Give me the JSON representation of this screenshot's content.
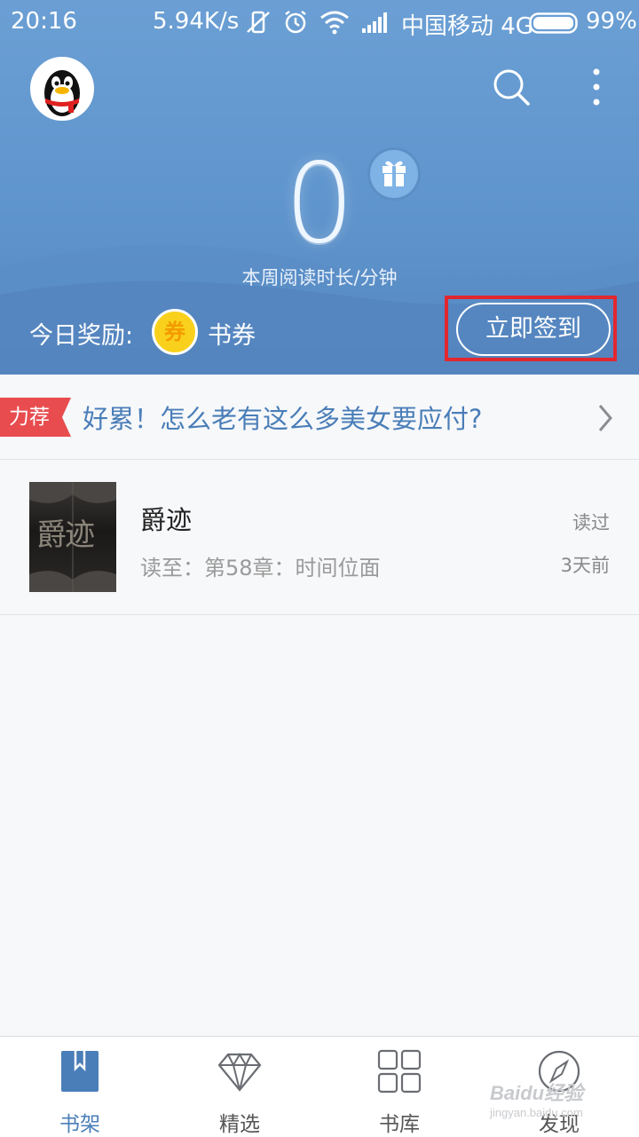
{
  "status_bar": {
    "time": "20:16",
    "speed": "5.94K/s",
    "carrier": "中国移动 4G",
    "battery": "99%",
    "battery_level": 0.99
  },
  "header": {
    "avatar_icon": "qq-penguin-avatar",
    "search_icon": "search-icon",
    "more_icon": "more-vertical-icon",
    "reading_minutes": "0",
    "reading_label": "本周阅读时长/分钟",
    "gift_icon": "gift-icon",
    "reward_label": "今日奖励:",
    "coupon_badge": "券",
    "coupon_text": "书券",
    "signin_label": "立即签到"
  },
  "recommendation": {
    "tag": "力荐",
    "text": "好累！怎么老有这么多美女要应付?"
  },
  "bookshelf": [
    {
      "title": "爵迹",
      "cover_text": "爵迹",
      "progress": "读至：第58章：时间位面",
      "status": "读过",
      "time": "3天前"
    }
  ],
  "bottom_nav": [
    {
      "label": "书架",
      "icon": "bookshelf-icon",
      "active": true
    },
    {
      "label": "精选",
      "icon": "diamond-icon",
      "active": false
    },
    {
      "label": "书库",
      "icon": "grid-icon",
      "active": false
    },
    {
      "label": "发现",
      "icon": "compass-icon",
      "active": false
    }
  ],
  "watermark": {
    "brand": "Baidu经验",
    "url": "jingyan.baidu.com"
  },
  "colors": {
    "header_blue": "#5f95cd",
    "accent_blue": "#4a7eb8",
    "tag_red": "#e84c4f",
    "highlight_red": "#e2272e",
    "coupon_yellow": "#f9d11c"
  }
}
